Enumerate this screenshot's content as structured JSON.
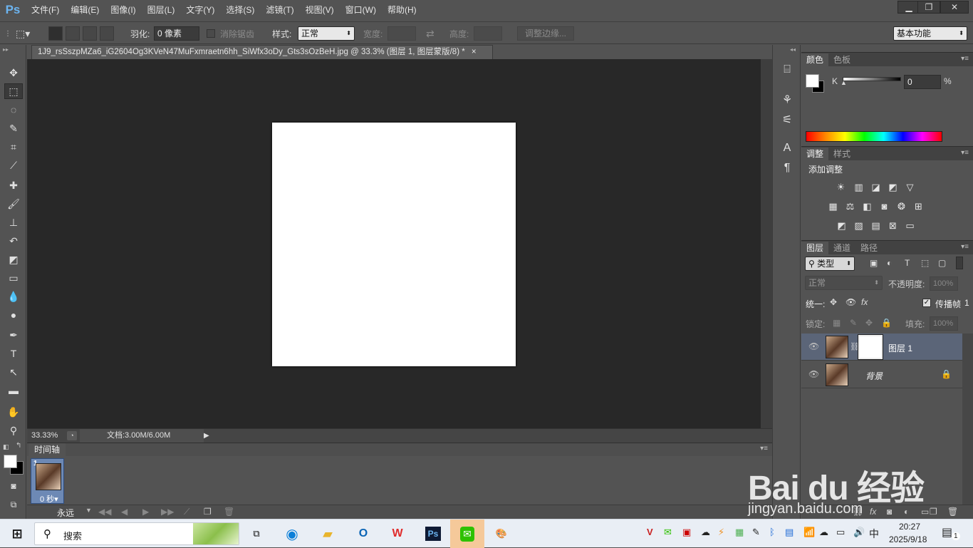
{
  "app": {
    "logo": "Ps",
    "menu": [
      "文件(F)",
      "编辑(E)",
      "图像(I)",
      "图层(L)",
      "文字(Y)",
      "选择(S)",
      "滤镜(T)",
      "视图(V)",
      "窗口(W)",
      "帮助(H)"
    ],
    "window_controls": [
      "minimize-icon",
      "restore-icon",
      "close-icon"
    ]
  },
  "options_bar": {
    "feather_label": "羽化:",
    "feather_value": "0 像素",
    "antialias_label": "消除锯齿",
    "style_label": "样式:",
    "style_value": "正常",
    "width_label": "宽度:",
    "height_label": "高度:",
    "refine_edge_label": "调整边缘...",
    "workspace_value": "基本功能"
  },
  "document": {
    "tab_title": "1J9_rsSszpMZa6_iG2604Og3KVeN47MuFxmraetn6hh_SiWfx3oDy_Gts3sOzBeH.jpg @ 33.3% (图层 1, 图层蒙版/8) *",
    "close": "×",
    "zoom": "33.33%",
    "doc_size": "文档:3.00M/6.00M"
  },
  "timeline": {
    "title": "时间轴",
    "frame_number": "1",
    "frame_delay": "0 秒▾",
    "loop": "永远"
  },
  "color_panel": {
    "tabs": [
      "颜色",
      "色板"
    ],
    "channel_label": "K",
    "value": "0",
    "unit": "%"
  },
  "adjust_panel": {
    "tabs": [
      "调整",
      "样式"
    ],
    "title": "添加调整"
  },
  "layers_panel": {
    "tabs": [
      "图层",
      "通道",
      "路径"
    ],
    "filter_kind": "类型",
    "blend_mode": "正常",
    "opacity_label": "不透明度:",
    "opacity_value": "100%",
    "unify_label": "统一:",
    "propagate_label": "传播帧",
    "propagate_value": "1",
    "lock_label": "锁定:",
    "fill_label": "填充:",
    "fill_value": "100%",
    "layers": [
      {
        "name": "图层 1",
        "selected": true
      },
      {
        "name": "背景",
        "locked": true
      }
    ]
  },
  "taskbar": {
    "search_placeholder": "搜索",
    "ime": "中",
    "time": "20:27",
    "date": "2025/9/18",
    "notification_count": "1",
    "watermark": "Bai du 经验",
    "watermark_url": "jingyan.baidu.com"
  }
}
